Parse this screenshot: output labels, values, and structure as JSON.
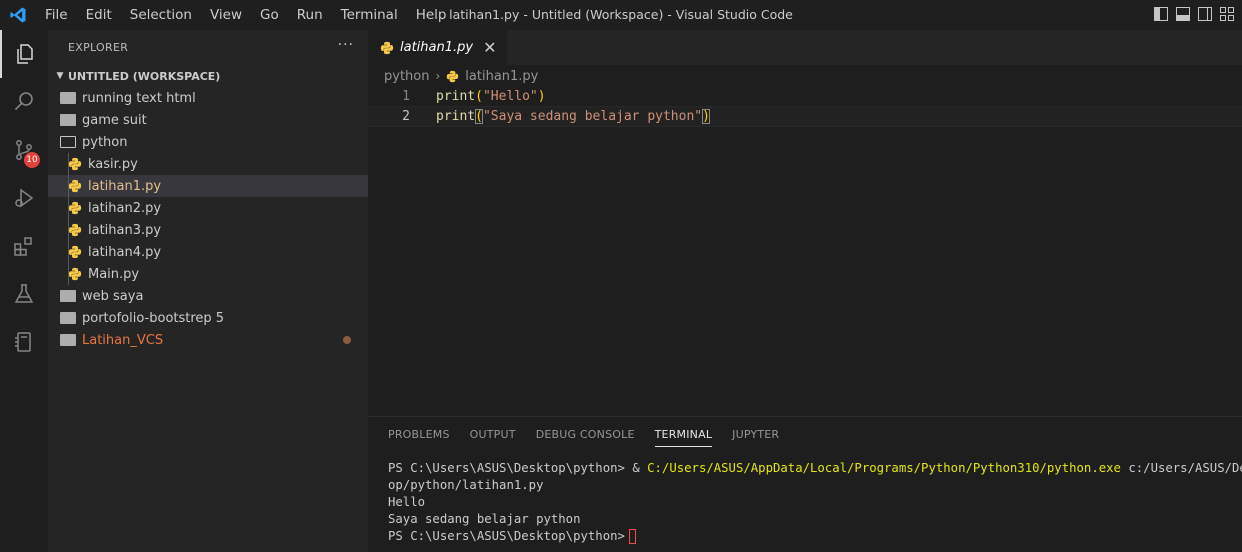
{
  "app": {
    "window_title": "latihan1.py - Untitled (Workspace) - Visual Studio Code",
    "menu": [
      "File",
      "Edit",
      "Selection",
      "View",
      "Go",
      "Run",
      "Terminal",
      "Help"
    ]
  },
  "activity": {
    "source_control_badge": "10"
  },
  "sidebar": {
    "title": "EXPLORER",
    "more": "···",
    "workspace": "UNTITLED (WORKSPACE)",
    "items": [
      {
        "label": "running text html",
        "type": "folder"
      },
      {
        "label": "game suit",
        "type": "folder"
      },
      {
        "label": "python",
        "type": "folder-open"
      },
      {
        "label": "kasir.py",
        "type": "py"
      },
      {
        "label": "latihan1.py",
        "type": "py",
        "selected": true
      },
      {
        "label": "latihan2.py",
        "type": "py"
      },
      {
        "label": "latihan3.py",
        "type": "py"
      },
      {
        "label": "latihan4.py",
        "type": "py"
      },
      {
        "label": "Main.py",
        "type": "py"
      },
      {
        "label": "web saya",
        "type": "folder"
      },
      {
        "label": "portofolio-bootstrep 5",
        "type": "folder"
      },
      {
        "label": "Latihan_VCS",
        "type": "folder",
        "modified": true
      }
    ]
  },
  "editor": {
    "tab": {
      "label": "latihan1.py",
      "close": "✕"
    },
    "breadcrumbs": {
      "folder": "python",
      "file": "latihan1.py"
    },
    "lines": [
      {
        "number": "1",
        "fn": "print",
        "open": "(",
        "str": "\"Hello\"",
        "close": ")"
      },
      {
        "number": "2",
        "fn": "print",
        "open": "(",
        "str": "\"Saya sedang belajar python\"",
        "close": ")"
      }
    ]
  },
  "panel": {
    "tabs": [
      "PROBLEMS",
      "OUTPUT",
      "DEBUG CONSOLE",
      "TERMINAL",
      "JUPYTER"
    ],
    "active_tab": "TERMINAL",
    "terminal": {
      "prompt": "PS C:\\Users\\ASUS\\Desktop\\python> ",
      "amp": "& ",
      "exe": "C:/Users/ASUS/AppData/Local/Programs/Python/Python310/python.exe",
      "arg_line1": " c:/Users/ASUS/Deskt",
      "arg_line2": "op/python/latihan1.py",
      "out1": "Hello",
      "out2": "Saya sedang belajar python",
      "prompt2": "PS C:\\Users\\ASUS\\Desktop\\python>"
    }
  },
  "colors": {
    "accent_python": "#f7c948",
    "string": "#ce9178",
    "function": "#dcdcaa",
    "bracket": "#ffd700",
    "exe_path": "#e5e510",
    "vcs_modified": "#e8773f"
  }
}
